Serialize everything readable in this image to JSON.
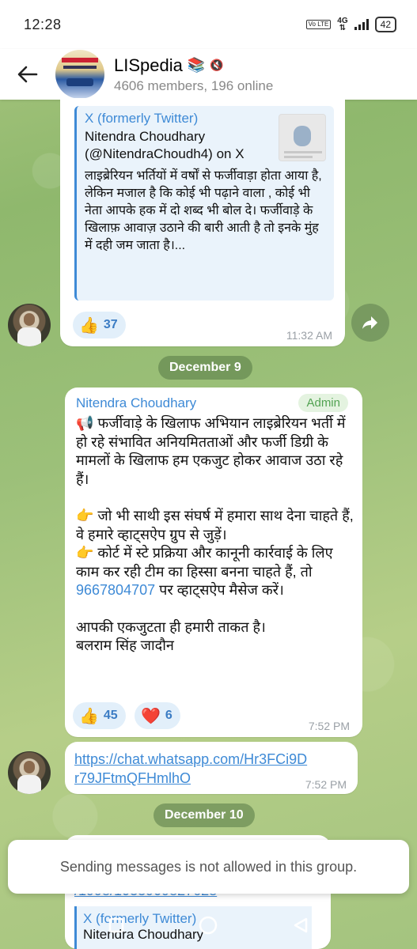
{
  "status_bar": {
    "time": "12:28",
    "network": "4G",
    "volte": "Vo LTE",
    "battery": "42"
  },
  "header": {
    "title": "LISpedia",
    "title_emoji": "📚",
    "subtitle": "4606 members, 196 online"
  },
  "messages": [
    {
      "preview": {
        "site": "X (formerly Twitter)",
        "title": "Nitendra Choudhary (@NitendraChoudh4) on X",
        "body": "लाइब्रेरियन भर्तियों में वर्षों से फर्जीवाड़ा होता आया है, लेकिन मजाल है कि कोई भी पढ़ाने वाला , कोई भी नेता आपके हक में दो शब्द भी बोल दे। फर्जीवाड़े के खिलाफ़ आवाज़ उठाने की बारी आती है तो इनके मुंह में दही जम जाता है।..."
      },
      "reactions": [
        {
          "emoji": "👍",
          "count": "37"
        }
      ],
      "time": "11:32 AM"
    },
    {
      "date_separator": "December 9",
      "sender": "Nitendra Choudhary",
      "tag": "Admin",
      "paragraphs": [
        "📢 फर्जीवाड़े के खिलाफ अभियान लाइब्रेरियन भर्ती में हो रहे संभावित अनियमितताओं और फर्जी डिग्री के मामलों के खिलाफ हम एकजुट होकर आवाज उठा रहे हैं।",
        "👉 जो भी साथी इस संघर्ष में हमारा साथ देना चाहते हैं, वे हमारे व्हाट्सऐप ग्रुप से जुड़ें।",
        "👉 कोर्ट में स्टे प्रक्रिया और कानूनी कार्रवाई के लिए काम कर रही टीम का हिस्सा बनना चाहते हैं, तो",
        "9667804707",
        "पर व्हाट्सऐप मैसेज करें।",
        "आपकी एकजुटता ही हमारी ताकत है।",
        "बलराम सिंह जादौन"
      ],
      "reactions": [
        {
          "emoji": "👍",
          "count": "45"
        },
        {
          "emoji": "❤️",
          "count": "6"
        }
      ],
      "time": "7:52 PM"
    },
    {
      "link": "https://chat.whatsapp.com/Hr3FCi9Dr79JFtmQFHmlhO",
      "time": "7:52 PM"
    },
    {
      "date_separator": "December 10",
      "partial_link": "/1998/1033909827628",
      "partial_preview_site": "X (formerly Twitter)",
      "partial_preview_title": "Nitendra Choudhary"
    }
  ],
  "toast": "Sending messages is not allowed in this group."
}
